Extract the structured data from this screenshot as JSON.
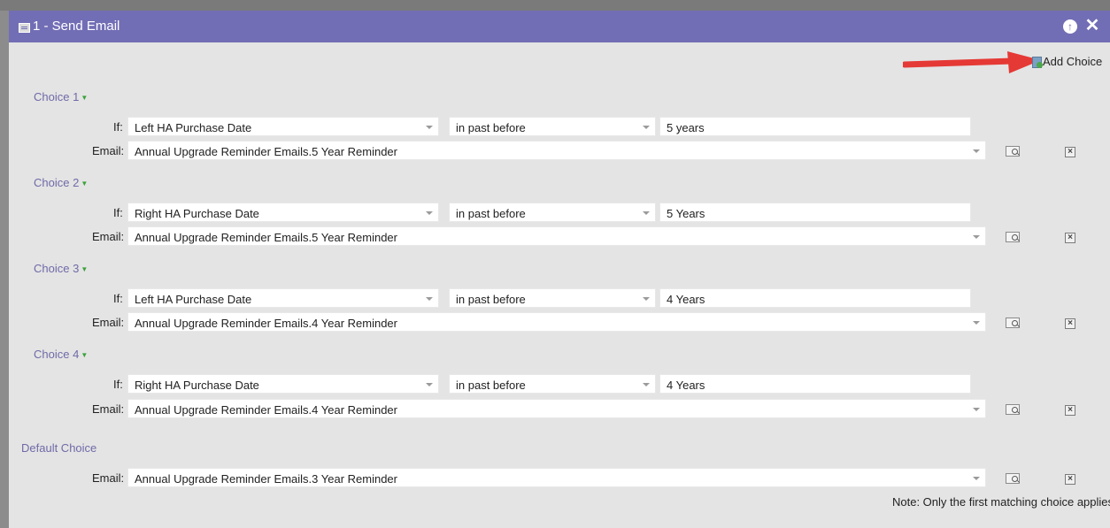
{
  "dialog": {
    "title": "1 - Send Email",
    "up_icon": "arrow-up-circle-icon",
    "close_icon": "close-icon",
    "close_glyph": "✕"
  },
  "toolbar": {
    "add_choice_label": "Add Choice"
  },
  "labels": {
    "if": "If:",
    "email": "Email:"
  },
  "choices": [
    {
      "heading": "Choice 1",
      "field": "Left HA Purchase Date",
      "operator": "in past before",
      "value": "5 years",
      "email": "Annual Upgrade Reminder Emails.5 Year Reminder"
    },
    {
      "heading": "Choice 2",
      "field": "Right HA Purchase Date",
      "operator": "in past before",
      "value": "5 Years",
      "email": "Annual Upgrade Reminder Emails.5 Year Reminder"
    },
    {
      "heading": "Choice 3",
      "field": "Left HA Purchase Date",
      "operator": "in past before",
      "value": "4 Years",
      "email": "Annual Upgrade Reminder Emails.4 Year Reminder"
    },
    {
      "heading": "Choice 4",
      "field": "Right HA Purchase Date",
      "operator": "in past before",
      "value": "4 Years",
      "email": "Annual Upgrade Reminder Emails.4 Year Reminder"
    }
  ],
  "default_choice": {
    "heading": "Default Choice",
    "email": "Annual Upgrade Reminder Emails.3 Year Reminder"
  },
  "note": "Note: Only the first matching choice applies",
  "colors": {
    "titlebar": "#726eb5",
    "heading": "#6f6aa8",
    "annotation_arrow": "#e53935"
  }
}
